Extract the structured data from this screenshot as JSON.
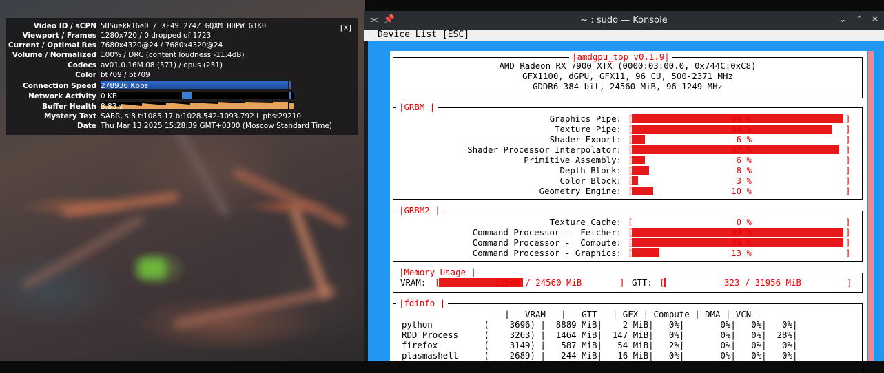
{
  "overlay": {
    "close": "[X]",
    "rows": [
      {
        "label": "Video ID / sCPN",
        "value": "5USuekk16e0 / XF49 274Z GQXM HDPW G1K0"
      },
      {
        "label": "Viewport / Frames",
        "value": "1280x720 / 0 dropped of 1723"
      },
      {
        "label": "Current / Optimal Res",
        "value": "7680x4320@24 / 7680x4320@24"
      },
      {
        "label": "Volume / Normalized",
        "value": "100% / DRC (content loudness -11.4dB)"
      },
      {
        "label": "Codecs",
        "value": "av01.0.16M.08 (571) / opus (251)"
      },
      {
        "label": "Color",
        "value": "bt709 / bt709"
      },
      {
        "label": "Connection Speed",
        "value": "278936 Kbps"
      },
      {
        "label": "Network Activity",
        "value": "0 KB"
      },
      {
        "label": "Buffer Health",
        "value": "8.83 s"
      },
      {
        "label": "Mystery Text",
        "value": "SABR, s:8 t:1085.17 b:1028.542-1093.792 L pbs:29210"
      },
      {
        "label": "Date",
        "value": "Thu Mar 13 2025 15:28:39 GMT+0300 (Moscow Standard Time)"
      }
    ]
  },
  "window": {
    "title": "~ : sudo — Konsole",
    "tab_label": "Device List [ESC]"
  },
  "app": {
    "title": "amdgpu_top v0.1.9",
    "device": [
      "AMD Radeon RX 7900 XTX (0000:03:00.0, 0x744C:0xC8)",
      "GFX1100, dGPU, GFX11, 96 CU, 500-2371 MHz",
      "GDDR6 384-bit, 24560 MiB, 96-1249 MHz"
    ],
    "grbm": {
      "title": "GRBM",
      "items": [
        {
          "name": "Graphics Pipe:",
          "pct": 99
        },
        {
          "name": "Texture Pipe:",
          "pct": 94
        },
        {
          "name": "Shader Export:",
          "pct": 6
        },
        {
          "name": "Shader Processor Interpolator:",
          "pct": 97
        },
        {
          "name": "Primitive Assembly:",
          "pct": 6
        },
        {
          "name": "Depth Block:",
          "pct": 8
        },
        {
          "name": "Color Block:",
          "pct": 3
        },
        {
          "name": "Geometry Engine:",
          "pct": 10
        }
      ]
    },
    "grbm2": {
      "title": "GRBM2",
      "items": [
        {
          "name": "Texture Cache:",
          "pct": 0
        },
        {
          "name": "Command Processor -  Fetcher:",
          "pct": 99
        },
        {
          "name": "Command Processor -  Compute:",
          "pct": 99
        },
        {
          "name": "Command Processor - Graphics:",
          "pct": 13
        }
      ]
    },
    "memory": {
      "title": "Memory Usage",
      "vram_label": "VRAM:",
      "vram_used": 11508,
      "vram_total": 24560,
      "vram_text": "11508 / 24560 MiB",
      "gtt_label": "GTT:",
      "gtt_text": "323 / 31956 MiB",
      "gtt_used": 323,
      "gtt_total": 31956
    },
    "fdinfo": {
      "title": "fdinfo",
      "header": "                    |   VRAM   |   GTT   | GFX | Compute | DMA | VCN |",
      "rows": [
        "python          (    3696) |  8889 MiB|    2 MiB|   0%|       0%|   0%|   0%|",
        "RDD Process     (    3263) |  1464 MiB|  147 MiB|   0%|       0%|   0%|  28%|",
        "firefox         (    3149) |   587 MiB|   54 MiB|   2%|       0%|   0%|   0%|",
        "plasmashell     (    2689) |   244 MiB|   16 MiB|   0%|       0%|   0%|   0%|"
      ]
    }
  }
}
